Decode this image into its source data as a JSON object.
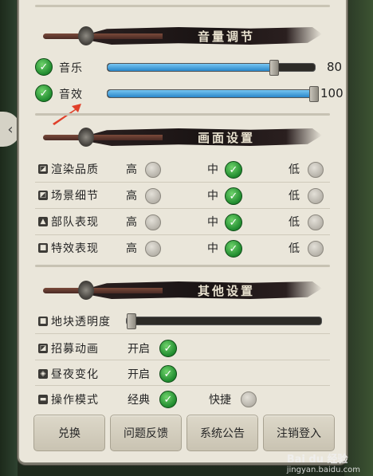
{
  "sections": {
    "volume": {
      "title": "音量调节"
    },
    "graphics": {
      "title": "画面设置"
    },
    "other": {
      "title": "其他设置"
    }
  },
  "volume": {
    "music": {
      "label": "音乐",
      "value": "80",
      "level": 0.8,
      "enabled": true
    },
    "sfx": {
      "label": "音效",
      "value": "100",
      "level": 1.0,
      "enabled": true
    }
  },
  "graphics": {
    "options": {
      "high": "高",
      "mid": "中",
      "low": "低"
    },
    "rows": [
      {
        "label": "渲染品质",
        "selected": "mid"
      },
      {
        "label": "场景细节",
        "selected": "mid"
      },
      {
        "label": "部队表现",
        "selected": "mid"
      },
      {
        "label": "特效表现",
        "selected": "mid"
      }
    ]
  },
  "other": {
    "transparency": {
      "label": "地块透明度",
      "level": 0.0
    },
    "recruit_anim": {
      "label": "招募动画",
      "option": "开启",
      "enabled": true
    },
    "day_night": {
      "label": "昼夜变化",
      "option": "开启",
      "enabled": true
    },
    "control_mode": {
      "label": "操作模式",
      "option1": "经典",
      "option2": "快捷",
      "selected": "经典"
    }
  },
  "buttons": {
    "redeem": "兑换",
    "feedback": "问题反馈",
    "announcement": "系统公告",
    "logout": "注销登入"
  },
  "watermark": {
    "brand": "Bai du 经验",
    "url": "jingyan.baidu.com"
  },
  "colors": {
    "accent_check": "#1f8a2e",
    "slider_fill": "#2a86c9",
    "panel_bg": "#eae6da",
    "arrow": "#e0402a"
  }
}
